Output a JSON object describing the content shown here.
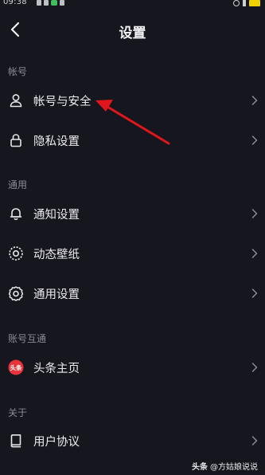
{
  "status_bar": {
    "time": "09:38"
  },
  "header": {
    "title": "设置"
  },
  "sections": {
    "account": {
      "title": "帐号",
      "items": [
        {
          "label": "帐号与安全",
          "icon": "user-icon"
        },
        {
          "label": "隐私设置",
          "icon": "lock-icon"
        }
      ]
    },
    "general": {
      "title": "通用",
      "items": [
        {
          "label": "通知设置",
          "icon": "bell-icon"
        },
        {
          "label": "动态壁纸",
          "icon": "wallpaper-icon"
        },
        {
          "label": "通用设置",
          "icon": "gear-icon"
        }
      ]
    },
    "linked": {
      "title": "账号互通",
      "items": [
        {
          "label": "头条主页",
          "icon": "toutiao-logo-icon",
          "badge": "头条"
        }
      ]
    },
    "about": {
      "title": "关于",
      "items": [
        {
          "label": "用户协议",
          "icon": "book-icon"
        }
      ]
    }
  },
  "watermark": {
    "brand": "头条",
    "text": "@方姑娘说说"
  },
  "colors": {
    "background": "#16161e",
    "annotation_arrow": "#e0161c",
    "toutiao_red": "#e8333a"
  }
}
